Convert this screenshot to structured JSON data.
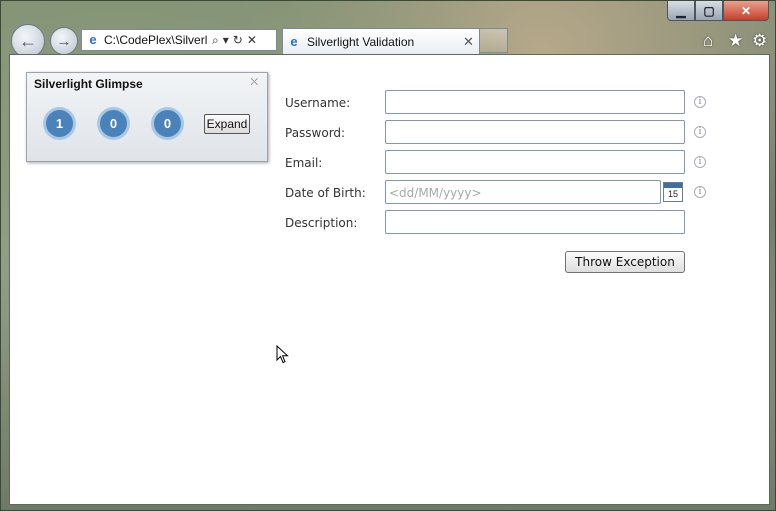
{
  "browser": {
    "address": "C:\\CodePlex\\Silverl",
    "tab_title": "Silverlight Validation",
    "back_icon": "back-arrow-icon",
    "forward_icon": "forward-arrow-icon",
    "tool_icons": [
      "home-icon",
      "star-icon",
      "gear-icon"
    ]
  },
  "glimpse": {
    "title": "Silverlight Glimpse",
    "counters": [
      "1",
      "0",
      "0"
    ],
    "expand_label": "Expand",
    "accent_color": "#4a82ba"
  },
  "form": {
    "username_label": "Username:",
    "password_label": "Password:",
    "email_label": "Email:",
    "dob_label": "Date of Birth:",
    "dob_placeholder": "<dd/MM/yyyy>",
    "calendar_day": "15",
    "description_label": "Description:",
    "throw_label": "Throw Exception"
  }
}
